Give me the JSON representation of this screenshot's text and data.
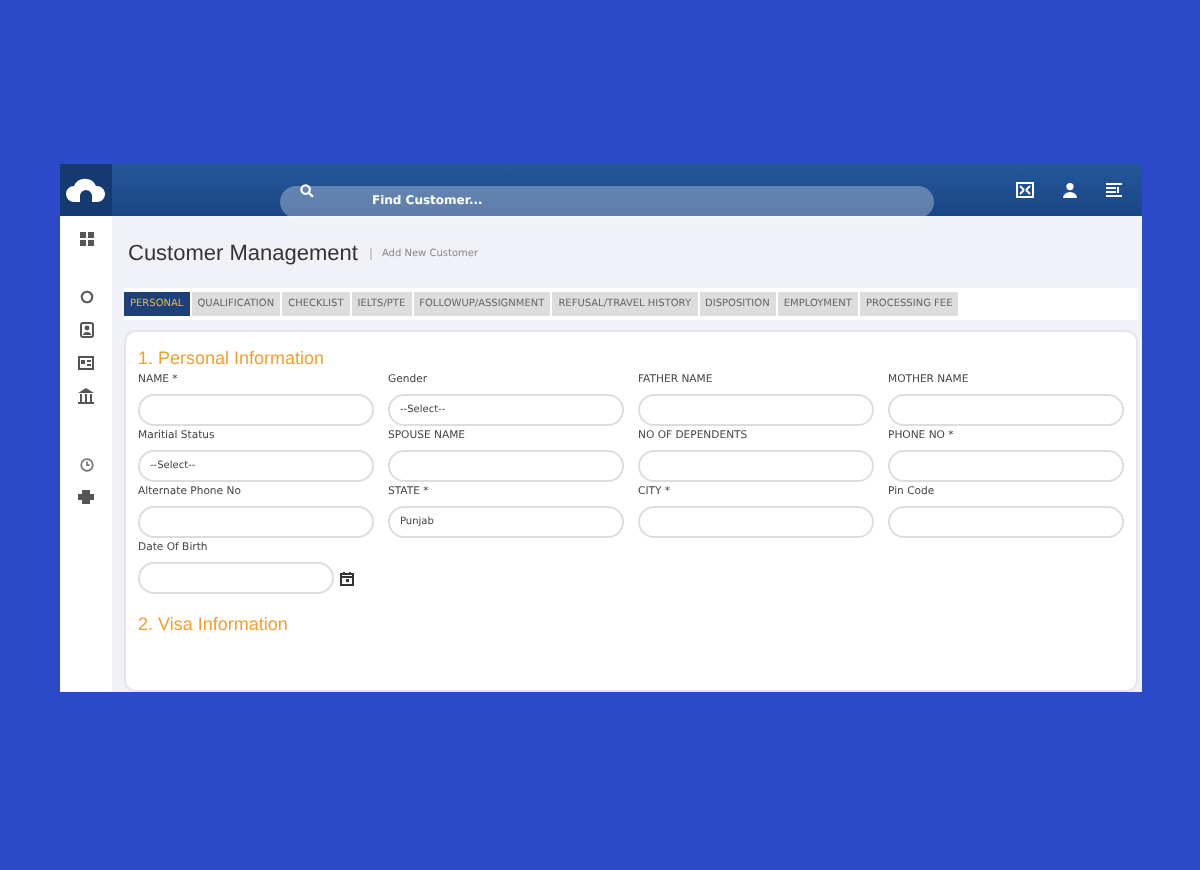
{
  "header": {
    "search": {
      "placeholder": "Find Customer..."
    }
  },
  "page": {
    "title": "Customer Management",
    "subtitle": "Add New Customer"
  },
  "tabs": [
    {
      "label": "PERSONAL",
      "selected": true
    },
    {
      "label": "QUALIFICATION",
      "selected": false
    },
    {
      "label": "CHECKLIST",
      "selected": false
    },
    {
      "label": "IELTS/PTE",
      "selected": false
    },
    {
      "label": "FOLLOWUP/ASSIGNMENT",
      "selected": false
    },
    {
      "label": "REFUSAL/TRAVEL HISTORY",
      "selected": false
    },
    {
      "label": "DISPOSITION",
      "selected": false
    },
    {
      "label": "EMPLOYMENT",
      "selected": false
    },
    {
      "label": "PROCESSING FEE",
      "selected": false
    }
  ],
  "sections": [
    {
      "title": "1. Personal Information",
      "fields": [
        {
          "label": "NAME *",
          "kind": "text"
        },
        {
          "label": "Gender",
          "kind": "select",
          "value": "--Select--"
        },
        {
          "label": "FATHER NAME",
          "kind": "text"
        },
        {
          "label": "MOTHER NAME",
          "kind": "text"
        },
        {
          "label": "Maritial Status",
          "kind": "select",
          "value": "--Select--"
        },
        {
          "label": "SPOUSE NAME",
          "kind": "text"
        },
        {
          "label": "NO OF DEPENDENTS",
          "kind": "text"
        },
        {
          "label": "PHONE NO *",
          "kind": "text"
        },
        {
          "label": "Alternate Phone No",
          "kind": "text"
        },
        {
          "label": "STATE *",
          "kind": "text",
          "value": "Punjab"
        },
        {
          "label": "CITY *",
          "kind": "text"
        },
        {
          "label": "Pin Code",
          "kind": "text"
        },
        {
          "label": "Date Of Birth",
          "kind": "date"
        }
      ]
    },
    {
      "title": "2. Visa Information"
    }
  ]
}
